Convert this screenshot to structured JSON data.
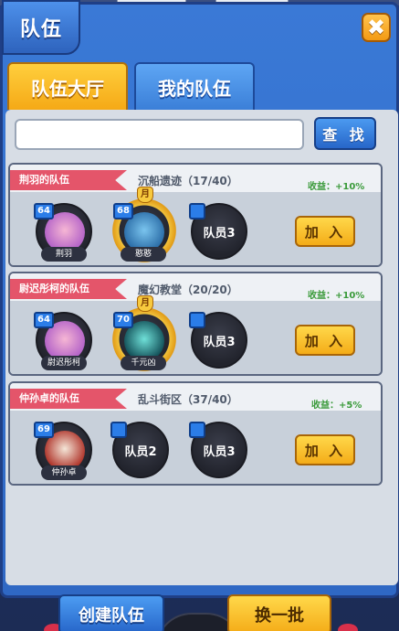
{
  "header": {
    "title": "队伍",
    "close_icon": "✖"
  },
  "tabs": [
    {
      "label": "队伍大厅",
      "active": true
    },
    {
      "label": "我的队伍",
      "active": false
    }
  ],
  "search": {
    "value": "",
    "placeholder": "",
    "button_label": "查 找"
  },
  "teams": [
    {
      "team_name": "荆羽的队伍",
      "map": "沉船遗迹（17/40）",
      "reward": "收益：+10%",
      "join_label": "加 入",
      "members": [
        {
          "level": "64",
          "name": "荆羽",
          "crown": false
        },
        {
          "level": "68",
          "name": "憨憨",
          "crown": true,
          "crown_char": "月"
        },
        {
          "empty_label": "队员3"
        }
      ]
    },
    {
      "team_name": "尉迟彤柯的队伍",
      "map": "魔幻教堂（20/20）",
      "reward": "收益：+10%",
      "join_label": "加 入",
      "members": [
        {
          "level": "64",
          "name": "尉迟彤柯",
          "crown": false
        },
        {
          "level": "70",
          "name": "千元凶",
          "crown": true,
          "crown_char": "月"
        },
        {
          "empty_label": "队员3"
        }
      ]
    },
    {
      "team_name": "仲孙卓的队伍",
      "map": "乱斗街区（37/40）",
      "reward": "收益：+5%",
      "join_label": "加 入",
      "members": [
        {
          "level": "69",
          "name": "仲孙卓",
          "crown": false
        },
        {
          "empty_label": "队员2"
        },
        {
          "empty_label": "队员3"
        }
      ]
    }
  ],
  "footer": {
    "create_label": "创建队伍",
    "refresh_label": "换一批"
  },
  "colors": {
    "accent_blue": "#2766c9",
    "accent_yellow": "#f4ac18",
    "ribbon_red": "#e4556a",
    "reward_green": "#3a9a3a"
  }
}
